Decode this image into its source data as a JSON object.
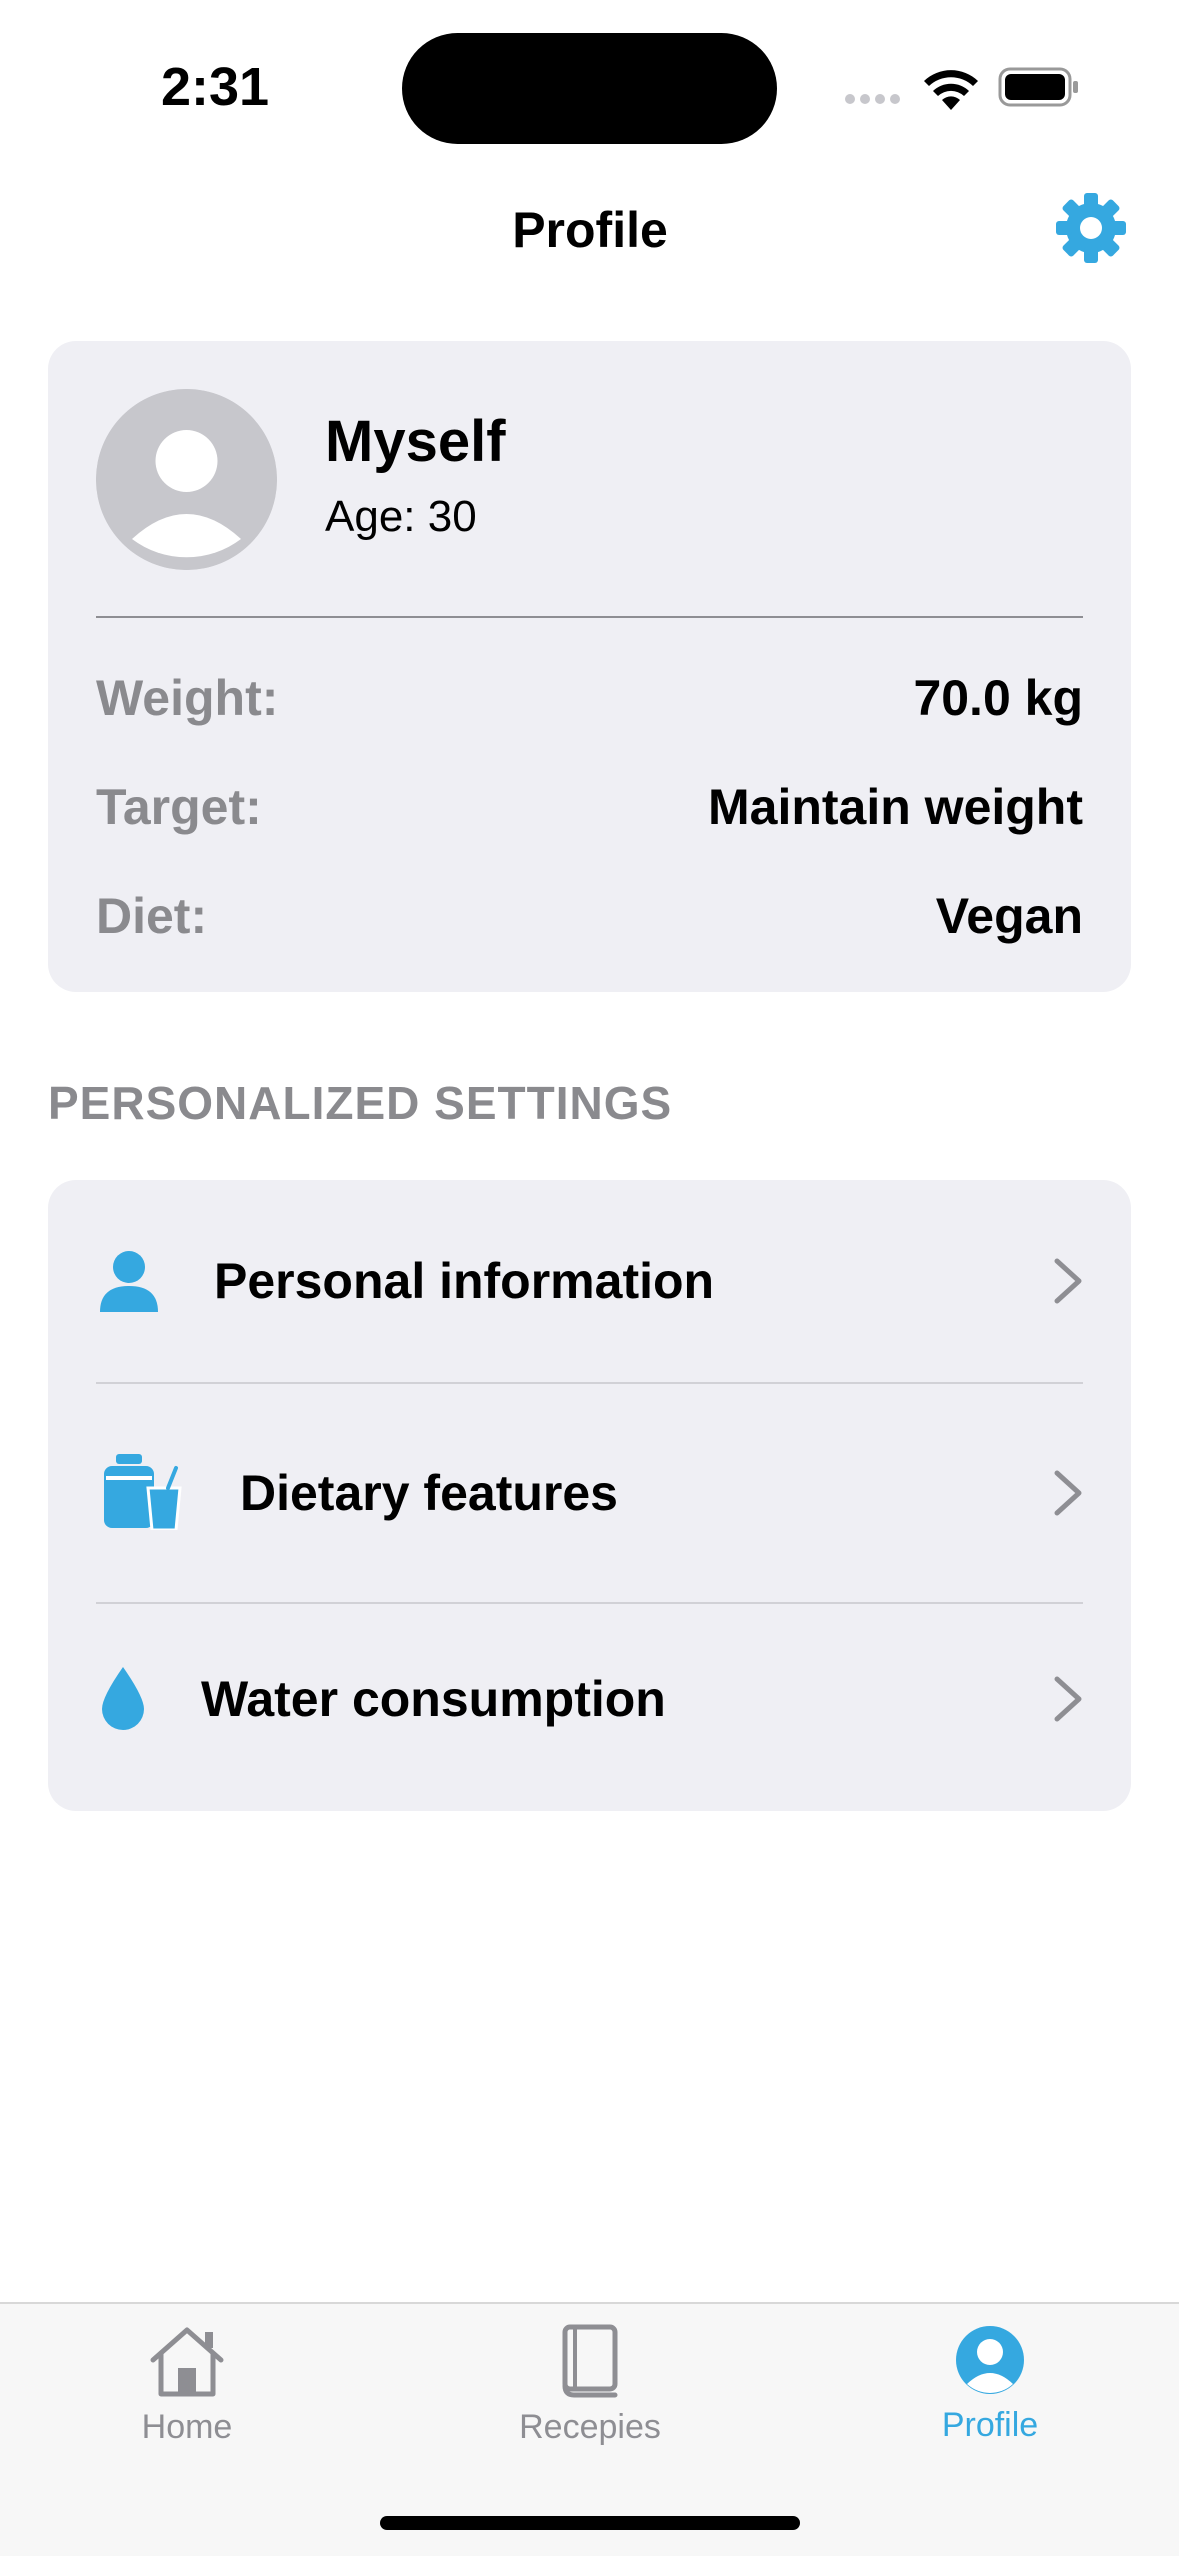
{
  "status_bar": {
    "time": "2:31",
    "icons": [
      "signal-dots-icon",
      "wifi-icon",
      "battery-icon"
    ]
  },
  "nav": {
    "title": "Profile",
    "settings_icon": "gear-icon"
  },
  "profile": {
    "name": "Myself",
    "age": "Age: 30",
    "rows": [
      {
        "label": "Weight:",
        "value": "70.0 kg"
      },
      {
        "label": "Target:",
        "value": "Maintain weight"
      },
      {
        "label": "Diet:",
        "value": "Vegan"
      }
    ]
  },
  "settings": {
    "section_title": "PERSONALIZED SETTINGS",
    "items": [
      {
        "label": "Personal information",
        "icon": "person-icon"
      },
      {
        "label": "Dietary features",
        "icon": "food-drink-icon"
      },
      {
        "label": "Water consumption",
        "icon": "water-drop-icon"
      }
    ]
  },
  "tab_bar": {
    "tabs": [
      {
        "label": "Home",
        "icon": "house-icon"
      },
      {
        "label": "Recepies",
        "icon": "book-icon"
      },
      {
        "label": "Profile",
        "icon": "person-circle-icon"
      }
    ],
    "active_tab": "Profile"
  },
  "colors": {
    "accent": "#35a8e0",
    "card_background": "#efeff4",
    "secondary_text": "#8a8a8e"
  }
}
